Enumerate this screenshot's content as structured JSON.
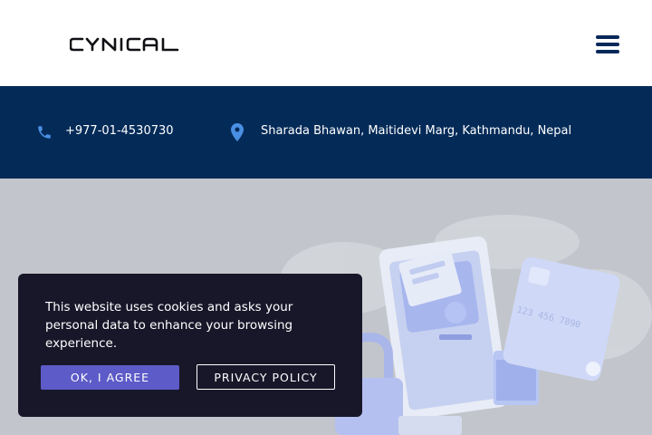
{
  "header": {
    "logo_text": "CYNICAL",
    "menu_icon": "hamburger-icon"
  },
  "contact": {
    "phone_icon": "phone-icon",
    "phone": "+977-01-4530730",
    "location_icon": "map-pin-icon",
    "address": "Sharada Bhawan, Maitidevi Marg, Kathmandu, Nepal"
  },
  "cookie_banner": {
    "message": "This website uses cookies and asks your personal data to enhance your browsing experience.",
    "agree_label": "OK, I AGREE",
    "policy_label": "PRIVACY POLICY"
  },
  "colors": {
    "header_bg": "#ffffff",
    "info_bar_bg": "#042b58",
    "accent_icon": "#4a90e2",
    "cookie_bg": "#18172a",
    "agree_button": "#5d5bc8"
  }
}
